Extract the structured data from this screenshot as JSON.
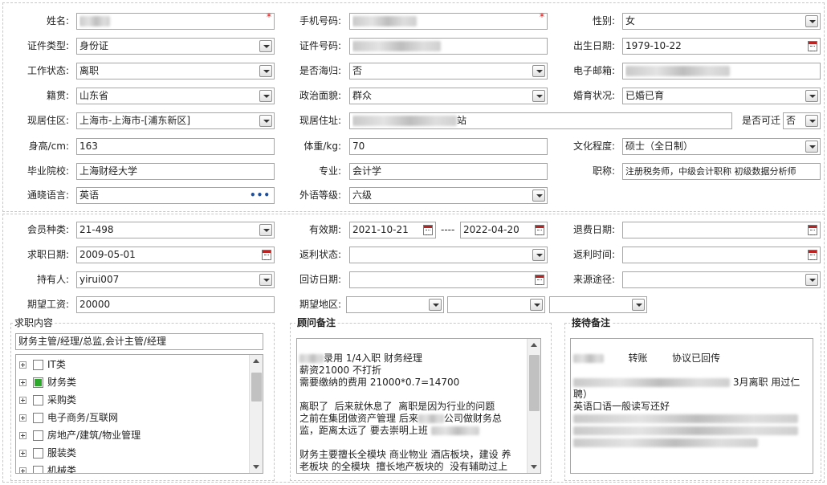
{
  "profile": {
    "name_label": "姓名:",
    "mobile_label": "手机号码:",
    "required_mark": "*",
    "gender_label": "性别:",
    "gender_value": "女",
    "idtype_label": "证件类型:",
    "idtype_value": "身份证",
    "idno_label": "证件号码:",
    "birth_label": "出生日期:",
    "birth_value": "1979-10-22",
    "work_label": "工作状态:",
    "work_value": "离职",
    "returnee_label": "是否海归:",
    "returnee_value": "否",
    "email_label": "电子邮箱:",
    "native_label": "籍贯:",
    "native_value": "山东省",
    "political_label": "政治面貌:",
    "political_value": "群众",
    "marital_label": "婚育状况:",
    "marital_value": "已婚已育",
    "area_label": "现居住区:",
    "area_value": "上海市-上海市-[浦东新区]",
    "address_label": "现居住址:",
    "address_suffix": "站",
    "relocate_label": "是否可迁",
    "relocate_value": "否",
    "height_label": "身高/cm:",
    "height_value": "163",
    "weight_label": "体重/kg:",
    "weight_value": "70",
    "edu_label": "文化程度:",
    "edu_value": "硕士（全日制）",
    "school_label": "毕业院校:",
    "school_value": "上海财经大学",
    "major_label": "专业:",
    "major_value": "会计学",
    "title_label": "职称:",
    "title_value": "注册税务师，中级会计职称 初级数据分析师",
    "lang_label": "通晓语言:",
    "lang_value": "英语",
    "lang_level_label": "外语等级:",
    "lang_level_value": "六级"
  },
  "member": {
    "type_label": "会员种类:",
    "type_value": "21-498",
    "valid_label": "有效期:",
    "valid_from": "2021-10-21",
    "valid_sep": "----",
    "valid_to": "2022-04-20",
    "refund_date_label": "退费日期:",
    "seek_date_label": "求职日期:",
    "seek_date_value": "2009-05-01",
    "rebate_status_label": "返利状态:",
    "rebate_time_label": "返利时间:",
    "holder_label": "持有人:",
    "holder_value": "yirui007",
    "visit_label": "回访日期:",
    "source_label": "来源途径:",
    "salary_label": "期望工资:",
    "salary_value": "20000",
    "region_label": "期望地区:"
  },
  "job": {
    "title": "求职内容",
    "summary": "财务主管/经理/总监,会计主管/经理",
    "items": [
      {
        "label": "IT类",
        "checked": false
      },
      {
        "label": "财务类",
        "checked": true
      },
      {
        "label": "采购类",
        "checked": false
      },
      {
        "label": "电子商务/互联网",
        "checked": false
      },
      {
        "label": "房地产/建筑/物业管理",
        "checked": false
      },
      {
        "label": "服装类",
        "checked": false
      },
      {
        "label": "机械类",
        "checked": false
      }
    ]
  },
  "advisor": {
    "title": "顾问备注",
    "lines": [
      "录用 1/4入职 财务经理",
      "薪资21000 不打折",
      "需要缴纳的费用 21000*0.7=14700",
      "",
      "离职了  后来就休息了  离职是因为行业的问题",
      "之前在集团做资产管理 后来",
      "公司做财务总",
      "监，距离太远了 要去崇明上班",
      "",
      "财务主要擅长全模块 商业物业 酒店板块，建设 养",
      "老板块 的全模块  擅长地产板块的  没有辅助过上"
    ]
  },
  "reception": {
    "title": "接待备注",
    "line1a": "转账",
    "line1b": "协议已回传",
    "line2": "3月离职 用过仁",
    "line3": "聘）",
    "line4": "英语口语一般读写还好"
  }
}
